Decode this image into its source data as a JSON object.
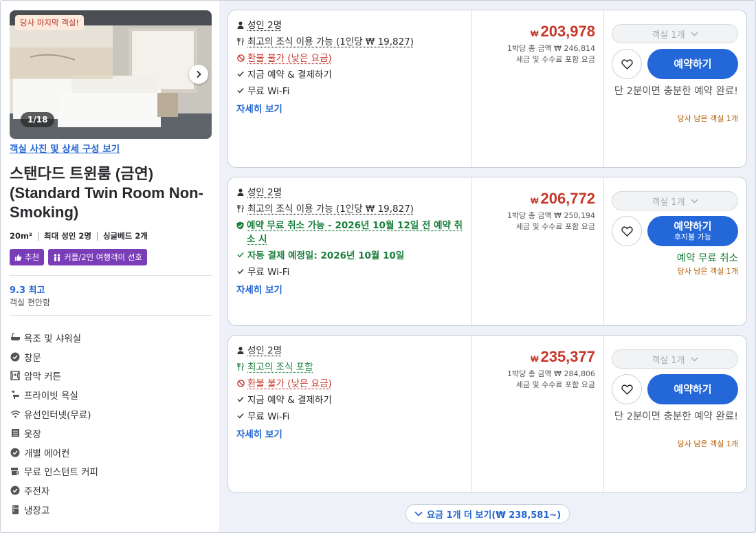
{
  "room": {
    "last_room_tag": "당사 마지막 객실!",
    "photo_counter": "1/18",
    "photo_link": "객실 사진 및 상세 구성 보기",
    "title": "스탠다드 트윈룸 (금연) (Standard Twin Room Non-Smoking)",
    "size": "20m²",
    "max_guests": "최대 성인 2명",
    "beds": "싱글베드 2개",
    "tags": [
      "추천",
      "커플/2인 여행객이 선호"
    ],
    "score": "9.3 최고",
    "score_label": "객실 편안함",
    "amenities": [
      {
        "icon": "bathtub-icon",
        "label": "욕조 및 샤워실"
      },
      {
        "icon": "check-circle-icon",
        "label": "창문"
      },
      {
        "icon": "blackout-curtain-icon",
        "label": "암막 커튼"
      },
      {
        "icon": "shower-icon",
        "label": "프라이빗 욕실"
      },
      {
        "icon": "wifi-icon",
        "label": "유선인터넷(무료)"
      },
      {
        "icon": "wardrobe-icon",
        "label": "옷장"
      },
      {
        "icon": "check-circle-icon",
        "label": "개별 에어컨"
      },
      {
        "icon": "coffee-icon",
        "label": "무료 인스턴트 커피"
      },
      {
        "icon": "check-circle-icon",
        "label": "주전자"
      },
      {
        "icon": "fridge-icon",
        "label": "냉장고"
      }
    ]
  },
  "offers": [
    {
      "guests": "성인 2명",
      "breakfast": "최고의 조식 이용 가능 (1인당 ₩ 19,827)",
      "policy": "환불 불가 (낮은 요금)",
      "payment": "지금 예약 & 결제하기",
      "wifi": "무료 Wi-Fi",
      "details_link": "자세히 보기",
      "currency": "₩",
      "price": "203,978",
      "total": "1박당 총 금액 ₩ 246,814",
      "tax_note": "세금 및 수수료 포함 요금",
      "rooms_select": "객실 1개",
      "book_label": "예약하기",
      "note": "단 2분이면 충분한 예약 완료!",
      "rooms_left": "당사 남은 객실 1개"
    },
    {
      "guests": "성인 2명",
      "breakfast": "최고의 조식 이용 가능 (1인당 ₩ 19,827)",
      "policy": "예약 무료 취소 가능 - 2026년 10월 12일 전 예약 취소 시",
      "payment": "자동 결제 예정일: 2026년 10월 10일",
      "wifi": "무료 Wi-Fi",
      "details_link": "자세히 보기",
      "currency": "₩",
      "price": "206,772",
      "total": "1박당 총 금액 ₩ 250,194",
      "tax_note": "세금 및 수수료 포함 요금",
      "rooms_select": "객실 1개",
      "book_label": "예약하기",
      "book_sub": "후지불 가능",
      "note": "예약 무료 취소",
      "rooms_left": "당사 남은 객실 1개"
    },
    {
      "guests": "성인 2명",
      "breakfast": "최고의 조식 포함",
      "policy": "환불 불가 (낮은 요금)",
      "payment": "지금 예약 & 결제하기",
      "wifi": "무료 Wi-Fi",
      "details_link": "자세히 보기",
      "currency": "₩",
      "price": "235,377",
      "total": "1박당 총 금액 ₩ 284,806",
      "tax_note": "세금 및 수수료 포함 요금",
      "rooms_select": "객실 1개",
      "book_label": "예약하기",
      "note": "단 2분이면 충분한 예약 완료!",
      "rooms_left": "당사 남은 객실 1개"
    }
  ],
  "more_rates": "요금 1개 더 보기(₩ 238,581~)",
  "colors": {
    "accent": "#2367d9",
    "price": "#c7372a",
    "free_cancel": "#1a7f3c",
    "tag": "#7a3db8",
    "rooms_left": "#b35a00"
  }
}
